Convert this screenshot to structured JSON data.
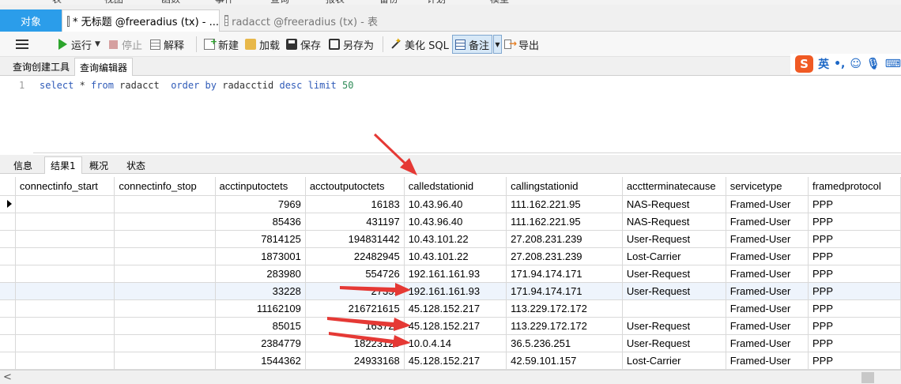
{
  "top_menu": [
    "表",
    "视图",
    "函数",
    "事件",
    "查询",
    "报表",
    "备份",
    "计划",
    "模型"
  ],
  "doc_tabs": {
    "object": "对象",
    "active": "* 无标题 @freeradius (tx) - ...",
    "inactive": "radacct @freeradius (tx) - 表"
  },
  "toolbar": {
    "run": "运行",
    "stop": "停止",
    "explain": "解释",
    "new": "新建",
    "load": "加载",
    "save": "保存",
    "save_as": "另存为",
    "beautify": "美化 SQL",
    "comment": "备注",
    "export": "导出"
  },
  "sub_tabs": [
    "查询创建工具",
    "查询编辑器"
  ],
  "ime": {
    "logo": "S",
    "lang": "英"
  },
  "editor": {
    "line_number": "1",
    "tokens": [
      {
        "t": "select",
        "c": "kw"
      },
      {
        "t": " * ",
        "c": "plain"
      },
      {
        "t": "from",
        "c": "kw"
      },
      {
        "t": " radacct  ",
        "c": "plain"
      },
      {
        "t": "order by",
        "c": "kw"
      },
      {
        "t": " radacctid ",
        "c": "plain"
      },
      {
        "t": "desc",
        "c": "kw"
      },
      {
        "t": " ",
        "c": "plain"
      },
      {
        "t": "limit",
        "c": "kw"
      },
      {
        "t": " ",
        "c": "plain"
      },
      {
        "t": "50",
        "c": "num"
      }
    ]
  },
  "result_tabs": [
    "信息",
    "结果1",
    "概况",
    "状态"
  ],
  "grid": {
    "columns": [
      "connectinfo_start",
      "connectinfo_stop",
      "acctinputoctets",
      "acctoutputoctets",
      "calledstationid",
      "callingstationid",
      "acctterminatecause",
      "servicetype",
      "framedprotocol"
    ],
    "rows": [
      [
        "",
        "",
        "7969",
        "16183",
        "10.43.96.40",
        "111.162.221.95",
        "NAS-Request",
        "Framed-User",
        "PPP"
      ],
      [
        "",
        "",
        "85436",
        "431197",
        "10.43.96.40",
        "111.162.221.95",
        "NAS-Request",
        "Framed-User",
        "PPP"
      ],
      [
        "",
        "",
        "7814125",
        "194831442",
        "10.43.101.22",
        "27.208.231.239",
        "User-Request",
        "Framed-User",
        "PPP"
      ],
      [
        "",
        "",
        "1873001",
        "22482945",
        "10.43.101.22",
        "27.208.231.239",
        "Lost-Carrier",
        "Framed-User",
        "PPP"
      ],
      [
        "",
        "",
        "283980",
        "554726",
        "192.161.161.93",
        "171.94.174.171",
        "User-Request",
        "Framed-User",
        "PPP"
      ],
      [
        "",
        "",
        "33228",
        "27351",
        "192.161.161.93",
        "171.94.174.171",
        "User-Request",
        "Framed-User",
        "PPP"
      ],
      [
        "",
        "",
        "11162109",
        "216721615",
        "45.128.152.217",
        "113.229.172.172",
        "",
        "Framed-User",
        "PPP"
      ],
      [
        "",
        "",
        "85015",
        "163720",
        "45.128.152.217",
        "113.229.172.172",
        "User-Request",
        "Framed-User",
        "PPP"
      ],
      [
        "",
        "",
        "2384779",
        "18223128",
        "10.0.4.14",
        "36.5.236.251",
        "User-Request",
        "Framed-User",
        "PPP"
      ],
      [
        "",
        "",
        "1544362",
        "24933168",
        "45.128.152.217",
        "42.59.101.157",
        "Lost-Carrier",
        "Framed-User",
        "PPP"
      ]
    ]
  },
  "colors": {
    "accent": "#2b9dea",
    "arrow": "#e53935",
    "run": "#2da52d"
  }
}
